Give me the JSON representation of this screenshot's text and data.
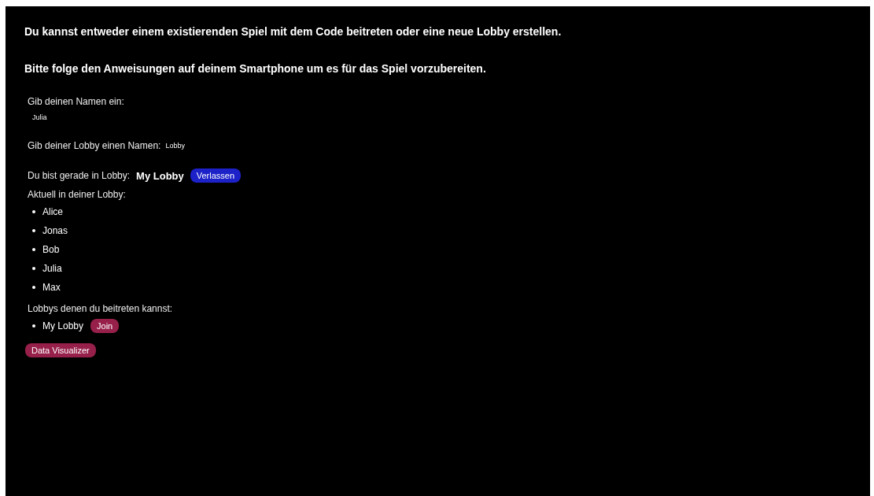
{
  "headings": [
    "Du kannst entweder einem existierenden Spiel mit dem Code beitreten oder eine neue Lobby erstellen.",
    "Bitte folge den Anweisungen auf deinem Smartphone um es für das Spiel vorzubereiten."
  ],
  "name_field": {
    "label": "Gib deinen Namen ein:",
    "value": "Julia"
  },
  "lobby_field": {
    "label": "Gib deiner Lobby einen Namen:",
    "value": "Lobby"
  },
  "current_lobby": {
    "label": "Du bist gerade in Lobby:",
    "name": "My Lobby",
    "button": "Verlassen"
  },
  "members": {
    "label": "Aktuell in deiner Lobby:",
    "items": [
      "Alice",
      "Jonas",
      "Bob",
      "Julia",
      "Max"
    ]
  },
  "joinable": {
    "label": "Lobbys denen du beitreten kannst:",
    "items": [
      {
        "name": "My Lobby",
        "button": "Join"
      }
    ]
  },
  "visualizer_button": "Data Visualizer"
}
